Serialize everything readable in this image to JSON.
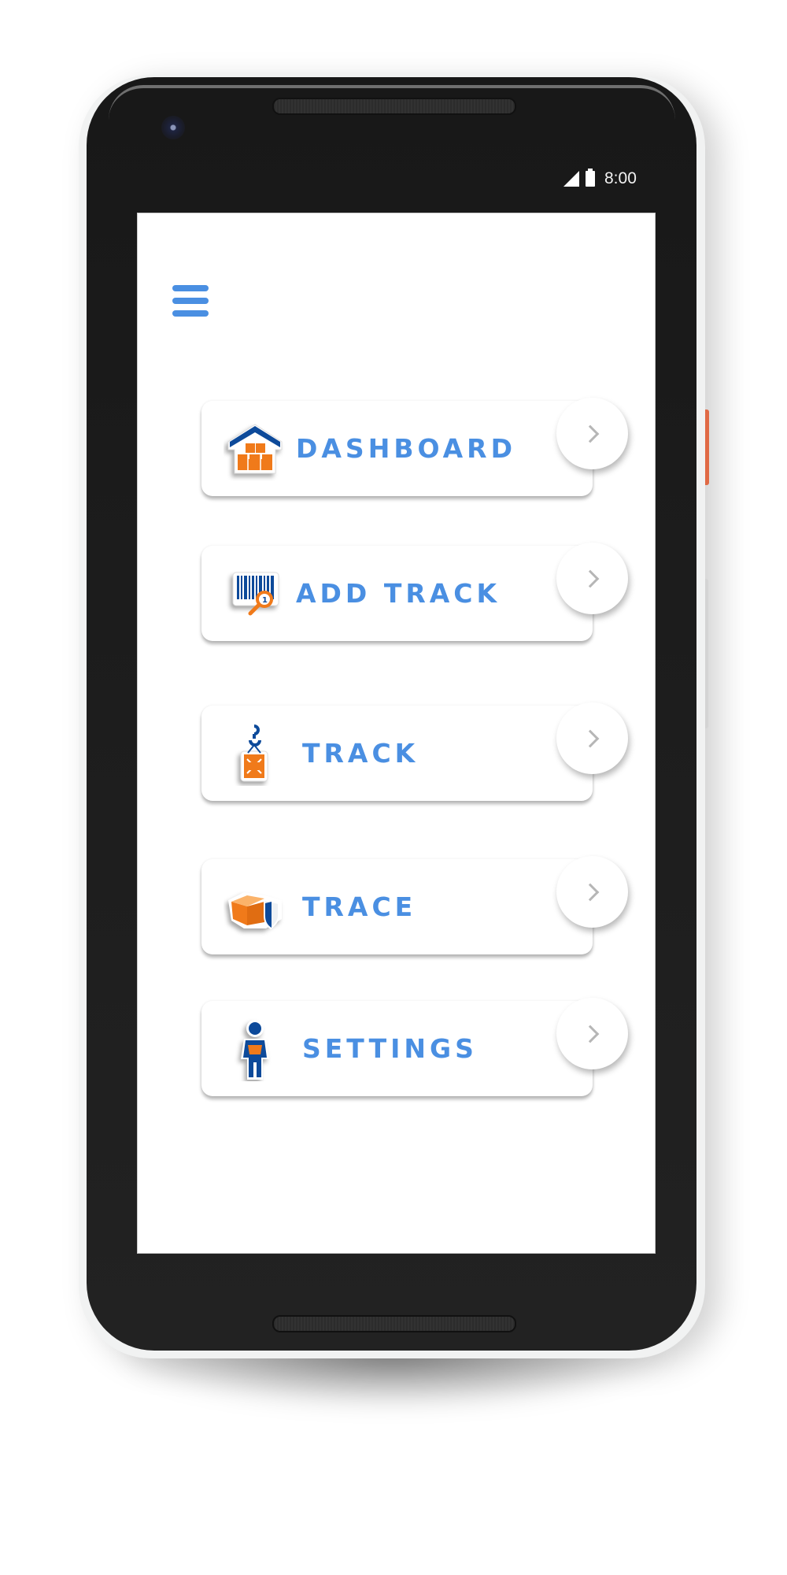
{
  "status_bar": {
    "signal_icon": "cellular-signal-icon",
    "battery_icon": "battery-full-icon",
    "time": "8:00"
  },
  "app_bar": {
    "menu_icon": "hamburger-menu-icon"
  },
  "menu": {
    "items": [
      {
        "label": "DASHBOARD",
        "icon": "warehouse-boxes-icon",
        "action_icon": "chevron-right-icon"
      },
      {
        "label": "ADD TRACK",
        "icon": "barcode-search-icon",
        "action_icon": "chevron-right-icon"
      },
      {
        "label": "TRACK",
        "icon": "crane-hook-crate-icon",
        "action_icon": "chevron-right-icon"
      },
      {
        "label": "TRACE",
        "icon": "box-shield-icon",
        "action_icon": "chevron-right-icon"
      },
      {
        "label": "SETTINGS",
        "icon": "worker-person-icon",
        "action_icon": "chevron-right-icon"
      }
    ]
  },
  "colors": {
    "accent_blue": "#4a8fe2",
    "icon_orange": "#f07a1a",
    "icon_navy": "#0d4a9a",
    "chevron_gray": "#b6b6b6",
    "device_side_button": "#e06a45"
  }
}
